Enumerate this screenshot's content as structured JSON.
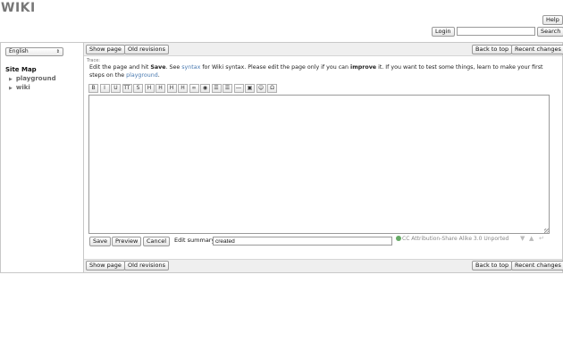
{
  "site": {
    "title": "WIKI"
  },
  "header": {
    "help_label": "Help",
    "login_label": "Login",
    "search_value": "",
    "search_label": "Search"
  },
  "sidebar": {
    "language": "English",
    "sitemap_title": "Site Map",
    "items": [
      {
        "label": "playground"
      },
      {
        "label": "wiki"
      }
    ]
  },
  "actions": {
    "show_page": "Show page",
    "old_revisions": "Old revisions",
    "back_to_top": "Back to top",
    "recent_changes": "Recent changes"
  },
  "trace": "Trace:",
  "instructions": {
    "t1": "Edit the page and hit ",
    "save_word": "Save",
    "t2": ". See ",
    "syntax_link": "syntax",
    "t3": " for Wiki syntax. Please edit the page only if you can ",
    "improve_word": "improve",
    "t4": " it. If you want to test some things, learn to make your first steps on the ",
    "playground_link": "playground",
    "t5": "."
  },
  "toolbar": {
    "buttons": [
      {
        "glyph": "B",
        "icon": "bold-icon"
      },
      {
        "glyph": "I",
        "icon": "italic-icon"
      },
      {
        "glyph": "U",
        "icon": "underline-icon"
      },
      {
        "glyph": "TT",
        "icon": "code-icon"
      },
      {
        "glyph": "S",
        "icon": "strike-icon"
      },
      {
        "glyph": "H",
        "icon": "heading-same-icon"
      },
      {
        "glyph": "H",
        "icon": "heading-lower-icon"
      },
      {
        "glyph": "H",
        "icon": "heading-higher-icon"
      },
      {
        "glyph": "H",
        "icon": "heading-select-icon"
      },
      {
        "glyph": "∞",
        "icon": "internal-link-icon"
      },
      {
        "glyph": "◉",
        "icon": "external-link-icon"
      },
      {
        "glyph": "☰",
        "icon": "ordered-list-icon"
      },
      {
        "glyph": "☰",
        "icon": "unordered-list-icon"
      },
      {
        "glyph": "―",
        "icon": "horizontal-rule-icon"
      },
      {
        "glyph": "▣",
        "icon": "media-icon"
      },
      {
        "glyph": "☺",
        "icon": "smiley-icon"
      },
      {
        "glyph": "Ω",
        "icon": "special-chars-icon"
      }
    ]
  },
  "editor": {
    "content": ""
  },
  "form": {
    "save_label": "Save",
    "preview_label": "Preview",
    "cancel_label": "Cancel",
    "summary_label": "Edit summary",
    "summary_value": "created"
  },
  "license": {
    "text": "CC Attribution-Share Alike 3.0 Unported"
  },
  "colors": {
    "link": "#4a7ab0",
    "border": "#c8c8c8",
    "bar_bg": "#efefef"
  }
}
